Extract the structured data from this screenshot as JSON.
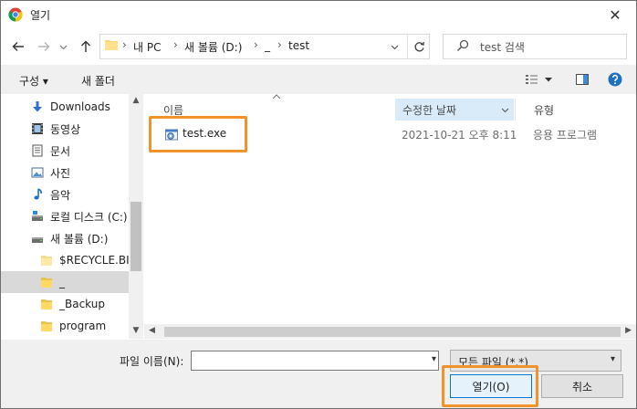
{
  "window": {
    "title": "열기",
    "close_glyph": "✕"
  },
  "address": {
    "crumbs": [
      "내 PC",
      "새 볼륨 (D:)",
      "_",
      "test"
    ],
    "separator": "›"
  },
  "search": {
    "placeholder": "test 검색"
  },
  "toolbar": {
    "organize": "구성 ▾",
    "new_folder": "새 폴더"
  },
  "nav_pane": {
    "items": [
      {
        "label": "Downloads",
        "icon": "download-arrow-icon"
      },
      {
        "label": "동영상",
        "icon": "video-icon"
      },
      {
        "label": "문서",
        "icon": "document-icon"
      },
      {
        "label": "사진",
        "icon": "picture-icon"
      },
      {
        "label": "음악",
        "icon": "music-note-icon"
      },
      {
        "label": "로컬 디스크 (C:)",
        "icon": "drive-icon"
      },
      {
        "label": "새 볼륨 (D:)",
        "icon": "drive-icon"
      },
      {
        "label": "$RECYCLE.BIN",
        "icon": "folder-icon"
      },
      {
        "label": "_",
        "icon": "folder-icon",
        "selected": true
      },
      {
        "label": "_Backup",
        "icon": "folder-icon"
      },
      {
        "label": "program",
        "icon": "folder-icon"
      }
    ]
  },
  "columns": {
    "name": "이름",
    "modified": "수정한 날짜",
    "type": "유형"
  },
  "files": [
    {
      "name": "test.exe",
      "modified": "2021-10-21 오후 8:11",
      "type": "응용 프로그램"
    }
  ],
  "footer": {
    "filename_label": "파일 이름(N):",
    "filename_value": "",
    "filetype": "모든 파일 (*.*)",
    "open_label": "열기(O)",
    "cancel_label": "취소"
  },
  "colors": {
    "highlight": "#f0932b",
    "selection": "#d9ebf9",
    "accent": "#0078d7"
  }
}
